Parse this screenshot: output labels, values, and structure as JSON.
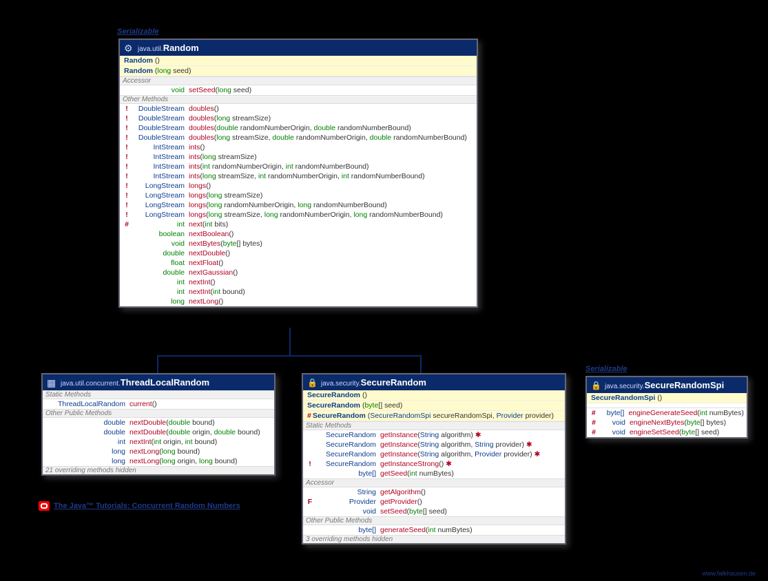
{
  "labels": {
    "serializable": "Serializable"
  },
  "random": {
    "pkg": "java.util.",
    "cls": "Random",
    "ctors": [
      {
        "name": "Random",
        "args": "()"
      },
      {
        "name": "Random",
        "args": "(long seed)",
        "typed": [
          {
            "kw": "long",
            "n": " seed"
          }
        ]
      }
    ],
    "sections": {
      "accessor": "Accessor",
      "other": "Other Methods"
    },
    "accessorRows": [
      {
        "mark": "",
        "rt": "void",
        "nm": "setSeed",
        "args": [
          {
            "t": "(",
            "k": ""
          },
          {
            "kw": "long"
          },
          {
            "t": " seed)"
          }
        ]
      }
    ],
    "otherRows": [
      {
        "mark": "!",
        "rt": "DoubleStream",
        "nm": "doubles",
        "args": [
          {
            "t": "()"
          }
        ]
      },
      {
        "mark": "!",
        "rt": "DoubleStream",
        "nm": "doubles",
        "args": [
          {
            "t": "("
          },
          {
            "kw": "long"
          },
          {
            "t": " streamSize)"
          }
        ]
      },
      {
        "mark": "!",
        "rt": "DoubleStream",
        "nm": "doubles",
        "args": [
          {
            "t": "("
          },
          {
            "kw": "double"
          },
          {
            "t": " randomNumberOrigin, "
          },
          {
            "kw": "double"
          },
          {
            "t": " randomNumberBound)"
          }
        ]
      },
      {
        "mark": "!",
        "rt": "DoubleStream",
        "nm": "doubles",
        "args": [
          {
            "t": "("
          },
          {
            "kw": "long"
          },
          {
            "t": " streamSize, "
          },
          {
            "kw": "double"
          },
          {
            "t": " randomNumberOrigin, "
          },
          {
            "kw": "double"
          },
          {
            "t": " randomNumberBound)"
          }
        ]
      },
      {
        "mark": "!",
        "rt": "IntStream",
        "nm": "ints",
        "args": [
          {
            "t": "()"
          }
        ]
      },
      {
        "mark": "!",
        "rt": "IntStream",
        "nm": "ints",
        "args": [
          {
            "t": "("
          },
          {
            "kw": "long"
          },
          {
            "t": " streamSize)"
          }
        ]
      },
      {
        "mark": "!",
        "rt": "IntStream",
        "nm": "ints",
        "args": [
          {
            "t": "("
          },
          {
            "kw": "int"
          },
          {
            "t": " randomNumberOrigin, "
          },
          {
            "kw": "int"
          },
          {
            "t": " randomNumberBound)"
          }
        ]
      },
      {
        "mark": "!",
        "rt": "IntStream",
        "nm": "ints",
        "args": [
          {
            "t": "("
          },
          {
            "kw": "long"
          },
          {
            "t": " streamSize, "
          },
          {
            "kw": "int"
          },
          {
            "t": " randomNumberOrigin, "
          },
          {
            "kw": "int"
          },
          {
            "t": " randomNumberBound)"
          }
        ]
      },
      {
        "mark": "!",
        "rt": "LongStream",
        "nm": "longs",
        "args": [
          {
            "t": "()"
          }
        ]
      },
      {
        "mark": "!",
        "rt": "LongStream",
        "nm": "longs",
        "args": [
          {
            "t": "("
          },
          {
            "kw": "long"
          },
          {
            "t": " streamSize)"
          }
        ]
      },
      {
        "mark": "!",
        "rt": "LongStream",
        "nm": "longs",
        "args": [
          {
            "t": "("
          },
          {
            "kw": "long"
          },
          {
            "t": " randomNumberOrigin, "
          },
          {
            "kw": "long"
          },
          {
            "t": " randomNumberBound)"
          }
        ]
      },
      {
        "mark": "!",
        "rt": "LongStream",
        "nm": "longs",
        "args": [
          {
            "t": "("
          },
          {
            "kw": "long"
          },
          {
            "t": " streamSize, "
          },
          {
            "kw": "long"
          },
          {
            "t": " randomNumberOrigin, "
          },
          {
            "kw": "long"
          },
          {
            "t": " randomNumberBound)"
          }
        ]
      },
      {
        "mark": "#",
        "rt": "int",
        "nm": "next",
        "args": [
          {
            "t": "("
          },
          {
            "kw": "int"
          },
          {
            "t": " bits)"
          }
        ]
      },
      {
        "mark": "",
        "rt": "boolean",
        "nm": "nextBoolean",
        "args": [
          {
            "t": "()"
          }
        ]
      },
      {
        "mark": "",
        "rt": "void",
        "nm": "nextBytes",
        "args": [
          {
            "t": "("
          },
          {
            "kw": "byte"
          },
          {
            "t": "[] bytes)"
          }
        ]
      },
      {
        "mark": "",
        "rt": "double",
        "nm": "nextDouble",
        "args": [
          {
            "t": "()"
          }
        ]
      },
      {
        "mark": "",
        "rt": "float",
        "nm": "nextFloat",
        "args": [
          {
            "t": "()"
          }
        ]
      },
      {
        "mark": "",
        "rt": "double",
        "nm": "nextGaussian",
        "args": [
          {
            "t": "()"
          }
        ]
      },
      {
        "mark": "",
        "rt": "int",
        "nm": "nextInt",
        "args": [
          {
            "t": "()"
          }
        ]
      },
      {
        "mark": "",
        "rt": "int",
        "nm": "nextInt",
        "args": [
          {
            "t": "("
          },
          {
            "kw": "int"
          },
          {
            "t": " bound)"
          }
        ]
      },
      {
        "mark": "",
        "rt": "long",
        "nm": "nextLong",
        "args": [
          {
            "t": "()"
          }
        ]
      }
    ]
  },
  "tlr": {
    "pkg": "java.util.concurrent.",
    "cls": "ThreadLocalRandom",
    "sections": {
      "static": "Static Methods",
      "other": "Other Public Methods"
    },
    "staticRows": [
      {
        "mark": "",
        "rt": "ThreadLocalRandom",
        "nm": "current",
        "args": [
          {
            "t": "()"
          }
        ]
      }
    ],
    "otherRows": [
      {
        "mark": "",
        "rt": "double",
        "nm": "nextDouble",
        "args": [
          {
            "t": "("
          },
          {
            "kw": "double"
          },
          {
            "t": " bound)"
          }
        ]
      },
      {
        "mark": "",
        "rt": "double",
        "nm": "nextDouble",
        "args": [
          {
            "t": "("
          },
          {
            "kw": "double"
          },
          {
            "t": " origin, "
          },
          {
            "kw": "double"
          },
          {
            "t": " bound)"
          }
        ]
      },
      {
        "mark": "",
        "rt": "int",
        "nm": "nextInt",
        "args": [
          {
            "t": "("
          },
          {
            "kw": "int"
          },
          {
            "t": " origin, "
          },
          {
            "kw": "int"
          },
          {
            "t": " bound)"
          }
        ]
      },
      {
        "mark": "",
        "rt": "long",
        "nm": "nextLong",
        "args": [
          {
            "t": "("
          },
          {
            "kw": "long"
          },
          {
            "t": " bound)"
          }
        ]
      },
      {
        "mark": "",
        "rt": "long",
        "nm": "nextLong",
        "args": [
          {
            "t": "("
          },
          {
            "kw": "long"
          },
          {
            "t": " origin, "
          },
          {
            "kw": "long"
          },
          {
            "t": " bound)"
          }
        ]
      }
    ],
    "hidden": "21 overriding methods hidden"
  },
  "secureRandom": {
    "pkg": "java.security.",
    "cls": "SecureRandom",
    "ctors": [
      {
        "name": "SecureRandom",
        "args": "()"
      },
      {
        "name": "SecureRandom",
        "typed": [
          {
            "kw": "byte",
            "n": "[] seed"
          }
        ]
      },
      {
        "mark": "#",
        "name": "SecureRandom",
        "typed": [
          {
            "tp": "SecureRandomSpi",
            "n": " secureRandomSpi, "
          },
          {
            "tp": "Provider",
            "n": " provider"
          }
        ]
      }
    ],
    "sections": {
      "static": "Static Methods",
      "accessor": "Accessor",
      "other": "Other Public Methods"
    },
    "staticRows": [
      {
        "mark": "",
        "rt": "SecureRandom",
        "nm": "getInstance",
        "args": [
          {
            "t": "("
          },
          {
            "tp": "String"
          },
          {
            "t": " algorithm) "
          }
        ],
        "exc": true
      },
      {
        "mark": "",
        "rt": "SecureRandom",
        "nm": "getInstance",
        "args": [
          {
            "t": "("
          },
          {
            "tp": "String"
          },
          {
            "t": " algorithm, "
          },
          {
            "tp": "String"
          },
          {
            "t": " provider) "
          }
        ],
        "exc": true
      },
      {
        "mark": "",
        "rt": "SecureRandom",
        "nm": "getInstance",
        "args": [
          {
            "t": "("
          },
          {
            "tp": "String"
          },
          {
            "t": " algorithm, "
          },
          {
            "tp": "Provider"
          },
          {
            "t": " provider) "
          }
        ],
        "exc": true
      },
      {
        "mark": "!",
        "rt": "SecureRandom",
        "nm": "getInstanceStrong",
        "args": [
          {
            "t": "() "
          }
        ],
        "exc": true
      },
      {
        "mark": "",
        "rt": "byte[]",
        "nm": "getSeed",
        "args": [
          {
            "t": "("
          },
          {
            "kw": "int"
          },
          {
            "t": " numBytes)"
          }
        ]
      }
    ],
    "accessorRows": [
      {
        "mark": "",
        "rt": "String",
        "nm": "getAlgorithm",
        "args": [
          {
            "t": "()"
          }
        ]
      },
      {
        "mark": "F",
        "rt": "Provider",
        "nm": "getProvider",
        "args": [
          {
            "t": "()"
          }
        ]
      },
      {
        "mark": "",
        "rt": "void",
        "nm": "setSeed",
        "args": [
          {
            "t": "("
          },
          {
            "kw": "byte"
          },
          {
            "t": "[] seed)"
          }
        ]
      }
    ],
    "otherRows": [
      {
        "mark": "",
        "rt": "byte[]",
        "nm": "generateSeed",
        "args": [
          {
            "t": "("
          },
          {
            "kw": "int"
          },
          {
            "t": " numBytes)"
          }
        ]
      }
    ],
    "hidden": "3 overriding methods hidden"
  },
  "spi": {
    "pkg": "java.security.",
    "cls": "SecureRandomSpi",
    "ctors": [
      {
        "name": "SecureRandomSpi",
        "args": "()"
      }
    ],
    "rows": [
      {
        "mark": "#",
        "rt": "byte[]",
        "nm": "engineGenerateSeed",
        "args": [
          {
            "t": "("
          },
          {
            "kw": "int"
          },
          {
            "t": " numBytes)"
          }
        ]
      },
      {
        "mark": "#",
        "rt": "void",
        "nm": "engineNextBytes",
        "args": [
          {
            "t": "("
          },
          {
            "kw": "byte"
          },
          {
            "t": "[] bytes)"
          }
        ]
      },
      {
        "mark": "#",
        "rt": "void",
        "nm": "engineSetSeed",
        "args": [
          {
            "t": "("
          },
          {
            "kw": "byte"
          },
          {
            "t": "[] seed)"
          }
        ]
      }
    ]
  },
  "footer": {
    "link": "The Java™ Tutorials: Concurrent Random Numbers",
    "credit": "www.falkhausen.de"
  }
}
